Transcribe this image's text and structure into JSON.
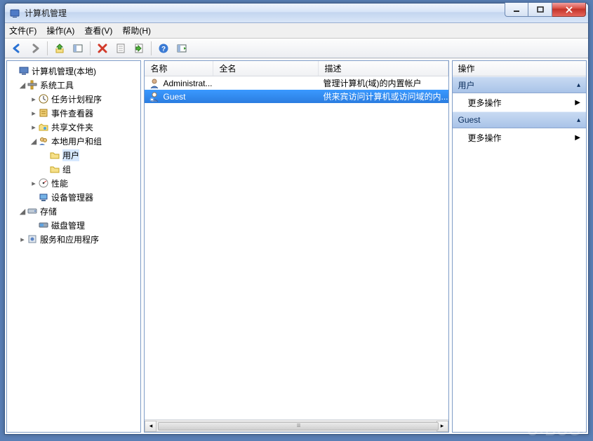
{
  "title": "计算机管理",
  "menu": {
    "file": "文件(F)",
    "action": "操作(A)",
    "view": "查看(V)",
    "help": "帮助(H)"
  },
  "tree": {
    "root": "计算机管理(本地)",
    "systools": "系统工具",
    "scheduler": "任务计划程序",
    "eventviewer": "事件查看器",
    "shared": "共享文件夹",
    "localusers": "本地用户和组",
    "users": "用户",
    "groups": "组",
    "perf": "性能",
    "devmgr": "设备管理器",
    "storage": "存储",
    "diskmgmt": "磁盘管理",
    "services": "服务和应用程序"
  },
  "columns": {
    "name": "名称",
    "fullname": "全名",
    "description": "描述"
  },
  "column_widths": {
    "name": 98,
    "fullname": 150,
    "description": 170
  },
  "rows": [
    {
      "name": "Administrat...",
      "fullname": "",
      "description": "管理计算机(域)的内置帐户",
      "disabled": false
    },
    {
      "name": "Guest",
      "fullname": "",
      "description": "供来宾访问计算机或访问域的内...",
      "disabled": true
    }
  ],
  "selected_row": 1,
  "actions": {
    "header": "操作",
    "sections": [
      {
        "title": "用户",
        "items": [
          "更多操作"
        ]
      },
      {
        "title": "Guest",
        "items": [
          "更多操作"
        ]
      }
    ]
  },
  "watermark": "U•BUG•"
}
